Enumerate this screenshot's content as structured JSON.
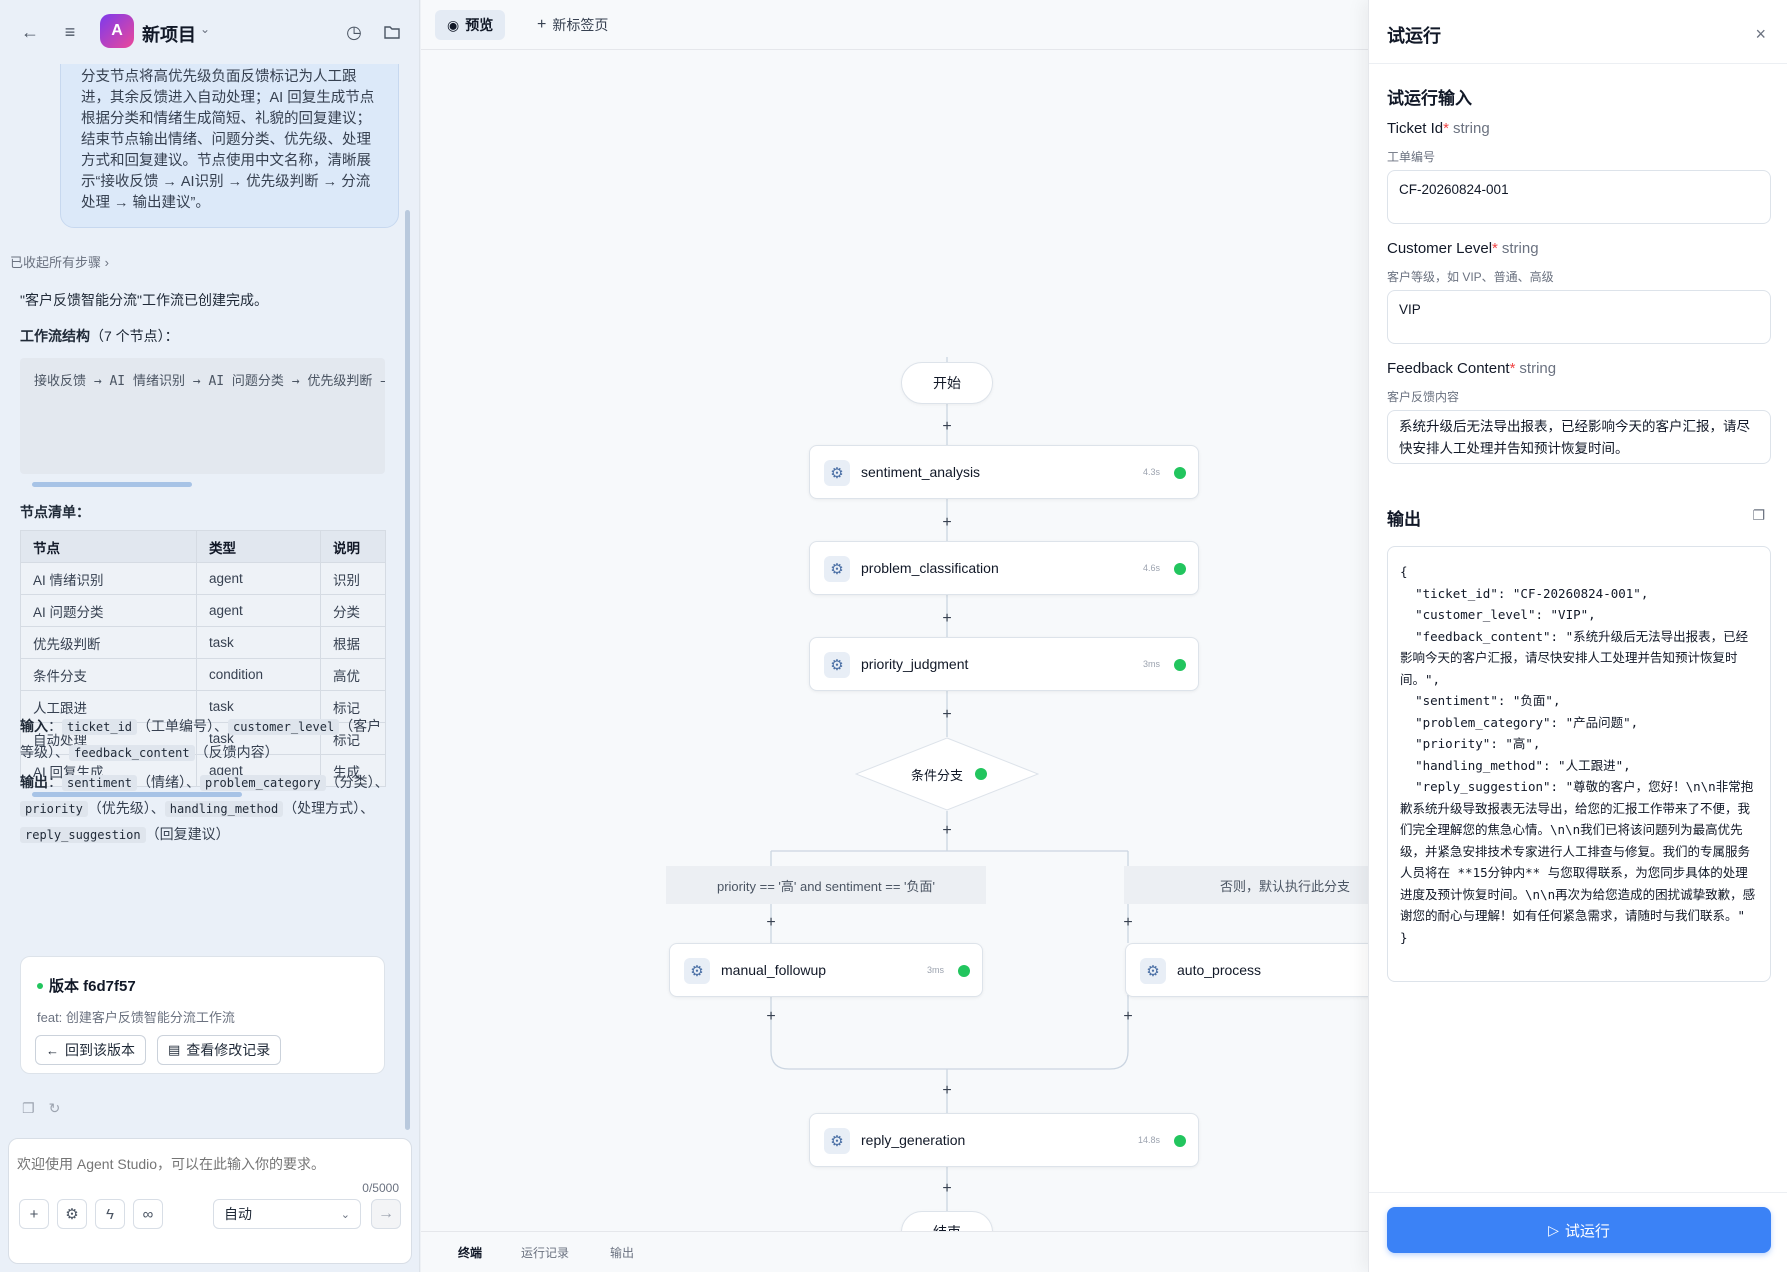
{
  "app": {
    "project_initial": "A",
    "project_name": "新项目",
    "icons": [
      "back-icon",
      "menu-icon",
      "chevron-down-icon",
      "history-icon",
      "folder-icon"
    ]
  },
  "chat": {
    "user_message": "分支节点将高优先级负面反馈标记为人工跟进，其余反馈进入自动处理；AI 回复生成节点根据分类和情绪生成简短、礼貌的回复建议；结束节点输出情绪、问题分类、优先级、处理方式和回复建议。节点使用中文名称，清晰展示“接收反馈 → AI识别 → 优先级判断 → 分流处理 → 输出建议”。",
    "steps_toggle": "已收起所有步骤",
    "done_message": "\"客户反馈智能分流\"工作流已创建完成。",
    "structure_title": "工作流结构",
    "structure_count": "（7 个节点）：",
    "structure_code": "接收反馈 → AI 情绪识别 → AI 问题分类 → 优先级判断 →",
    "node_list_title": "节点清单",
    "table": {
      "headers": [
        "节点",
        "类型",
        "说明"
      ],
      "rows": [
        [
          "AI 情绪识别",
          "agent",
          "识别"
        ],
        [
          "AI 问题分类",
          "agent",
          "分类"
        ],
        [
          "优先级判断",
          "task",
          "根据"
        ],
        [
          "条件分支",
          "condition",
          "高优"
        ],
        [
          "人工跟进",
          "task",
          "标记"
        ],
        [
          "自动处理",
          "task",
          "标记"
        ],
        [
          "AI 回复生成",
          "agent",
          "生成"
        ]
      ]
    },
    "inputs": {
      "label": "输入",
      "items": [
        {
          "code": "ticket_id",
          "desc": "（工单编号）"
        },
        {
          "code": "customer_level",
          "desc": "（客户等级）"
        },
        {
          "code": "feedback_content",
          "desc": "（反馈内容）"
        }
      ]
    },
    "outputs": {
      "label": "输出",
      "items": [
        {
          "code": "sentiment",
          "desc": "（情绪）"
        },
        {
          "code": "problem_category",
          "desc": "（分类）"
        },
        {
          "code": "priority",
          "desc": "（优先级）"
        },
        {
          "code": "handling_method",
          "desc": "（处理方式）"
        },
        {
          "code": "reply_suggestion",
          "desc": "（回复建议）"
        }
      ]
    },
    "version": {
      "title": "版本 f6d7f57",
      "desc": "feat: 创建客户反馈智能分流工作流",
      "revert_label": "回到该版本",
      "history_label": "查看修改记录"
    }
  },
  "composer": {
    "placeholder": "欢迎使用 Agent Studio，可以在此输入你的要求。",
    "char_count": "0/5000",
    "mode": "自动"
  },
  "center": {
    "tabs": {
      "preview": "预览",
      "new_tab": "新标签页"
    },
    "nodes": {
      "start": "开始",
      "sentiment": {
        "label": "sentiment_analysis",
        "time": "4.3s"
      },
      "problem": {
        "label": "problem_classification",
        "time": "4.6s"
      },
      "priority": {
        "label": "priority_judgment",
        "time": "3ms"
      },
      "condition": "条件分支",
      "branch_true": "priority == '高' and sentiment == '负面'",
      "branch_else": "否则，默认执行此分支",
      "manual": {
        "label": "manual_followup",
        "time": "3ms"
      },
      "auto": {
        "label": "auto_process"
      },
      "reply": {
        "label": "reply_generation",
        "time": "14.8s"
      },
      "end": "结束"
    },
    "bottom_tabs": [
      "终端",
      "运行记录",
      "输出"
    ]
  },
  "trial": {
    "title": "试运行",
    "input_title": "试运行输入",
    "fields": [
      {
        "name": "Ticket Id",
        "type": "string",
        "desc": "工单编号",
        "value": "CF-20260824-001"
      },
      {
        "name": "Customer Level",
        "type": "string",
        "desc": "客户等级，如 VIP、普通、高级",
        "value": "VIP"
      },
      {
        "name": "Feedback Content",
        "type": "string",
        "desc": "客户反馈内容",
        "value": "系统升级后无法导出报表，已经影响今天的客户汇报，请尽快安排人工处理并告知预计恢复时间。"
      }
    ],
    "output_title": "输出",
    "output_json": "{\n  \"ticket_id\": \"CF-20260824-001\",\n  \"customer_level\": \"VIP\",\n  \"feedback_content\": \"系统升级后无法导出报表，已经影响今天的客户汇报，请尽快安排人工处理并告知预计恢复时间。\",\n  \"sentiment\": \"负面\",\n  \"problem_category\": \"产品问题\",\n  \"priority\": \"高\",\n  \"handling_method\": \"人工跟进\",\n  \"reply_suggestion\": \"尊敬的客户，您好！\\n\\n非常抱歉系统升级导致报表无法导出，给您的汇报工作带来了不便，我们完全理解您的焦急心情。\\n\\n我们已将该问题列为最高优先级，并紧急安排技术专家进行人工排查与修复。我们的专属服务人员将在 **15分钟内** 与您取得联系，为您同步具体的处理进度及预计恢复时间。\\n\\n再次为给您造成的困扰诚挚致歉，感谢您的耐心与理解！如有任何紧急需求，请随时与我们联系。\"\n}",
    "run_label": "试运行"
  },
  "colors": {
    "accent": "#3b82f6",
    "success": "#22c55e",
    "required": "#ef4444"
  }
}
